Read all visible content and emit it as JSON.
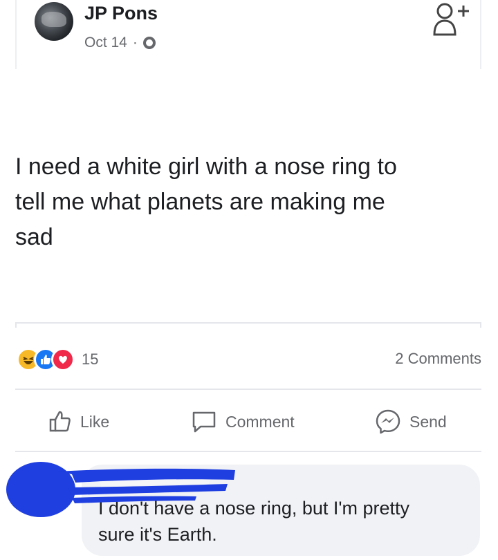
{
  "post": {
    "author": "JP Pons",
    "date": "Oct 14",
    "separator": "·",
    "privacy_icon": "globe-icon",
    "text_lines": [
      "I need a white girl with a nose ring to",
      "tell me what planets are making me",
      "sad"
    ]
  },
  "reactions": {
    "types": [
      "haha",
      "like",
      "love"
    ],
    "count": "15",
    "comments": "2 Comments"
  },
  "actions": {
    "like": "Like",
    "comment": "Comment",
    "send": "Send"
  },
  "comment": {
    "lines": [
      "I don't have a nose ring, but I'm pretty",
      "sure it's Earth."
    ]
  },
  "colors": {
    "text_primary": "#1c1e21",
    "text_secondary": "#65676b",
    "like_blue": "#1877f2",
    "love_red": "#f02849",
    "haha_yellow": "#f7b928",
    "redaction_blue": "#1f3fe0",
    "comment_bg": "#f0f2f5"
  }
}
